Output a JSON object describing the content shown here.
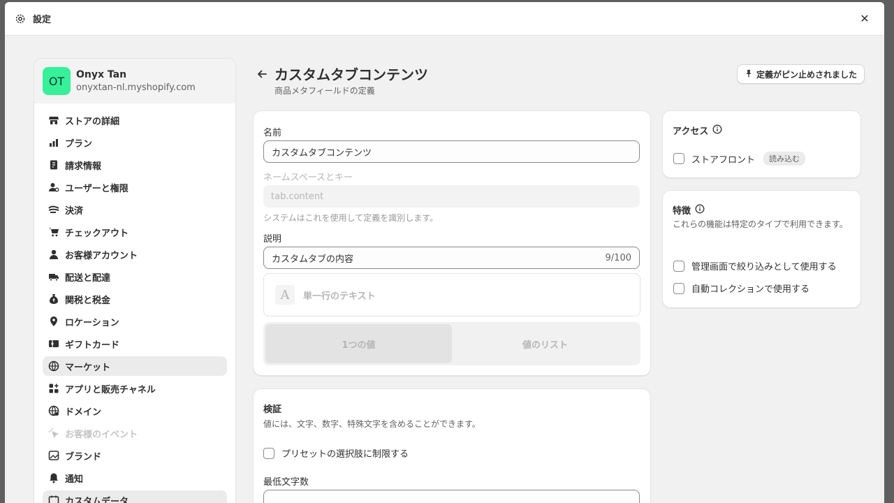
{
  "window": {
    "title": "設定",
    "close_label": "✕"
  },
  "store": {
    "initials": "OT",
    "name": "Onyx Tan",
    "url": "onyxtan-nl.myshopify.com"
  },
  "nav": [
    {
      "label": "ストアの詳細",
      "icon": "store-icon"
    },
    {
      "label": "プラン",
      "icon": "plan-icon"
    },
    {
      "label": "請求情報",
      "icon": "billing-icon"
    },
    {
      "label": "ユーザーと権限",
      "icon": "users-icon"
    },
    {
      "label": "決済",
      "icon": "payments-icon"
    },
    {
      "label": "チェックアウト",
      "icon": "cart-icon"
    },
    {
      "label": "お客様アカウント",
      "icon": "person-icon"
    },
    {
      "label": "配送と配達",
      "icon": "truck-icon"
    },
    {
      "label": "関税と税金",
      "icon": "tax-icon"
    },
    {
      "label": "ロケーション",
      "icon": "location-icon"
    },
    {
      "label": "ギフトカード",
      "icon": "gift-card-icon"
    },
    {
      "label": "マーケット",
      "icon": "globe-icon",
      "active": true
    },
    {
      "label": "アプリと販売チャネル",
      "icon": "apps-icon"
    },
    {
      "label": "ドメイン",
      "icon": "domain-icon"
    },
    {
      "label": "お客様のイベント",
      "icon": "events-icon",
      "disabled": true
    },
    {
      "label": "ブランド",
      "icon": "brand-icon"
    },
    {
      "label": "通知",
      "icon": "bell-icon"
    },
    {
      "label": "カスタムデータ",
      "icon": "custom-data-icon",
      "active": true
    }
  ],
  "page": {
    "title": "カスタムタブコンテンツ",
    "subtitle": "商品メタフィールドの定義",
    "pin_button": "定義がピン止めされました"
  },
  "form": {
    "name_label": "名前",
    "name_value": "カスタムタブコンテンツ",
    "namespace_label": "ネームスペースとキー",
    "namespace_value": "tab.content",
    "namespace_help": "システムはこれを使用して定義を識別します。",
    "description_label": "説明",
    "description_value": "カスタムタブの内容",
    "description_counter": "9/100",
    "type_icon_letter": "A",
    "type_label": "単一行のテキスト",
    "segment_single": "1つの値",
    "segment_list": "値のリスト"
  },
  "validation": {
    "title": "検証",
    "description": "値には、文字、数字、特殊文字を含めることができます。",
    "preset_label": "プリセットの選択肢に制限する",
    "min_chars_label": "最低文字数"
  },
  "access": {
    "title": "アクセス",
    "storefront_label": "ストアフロント",
    "storefront_badge": "読み込む"
  },
  "features": {
    "title": "特徴",
    "description": "これらの機能は特定のタイプで利用できます。",
    "filter_label": "管理画面で絞り込みとして使用する",
    "collection_label": "自動コレクションで使用する"
  }
}
